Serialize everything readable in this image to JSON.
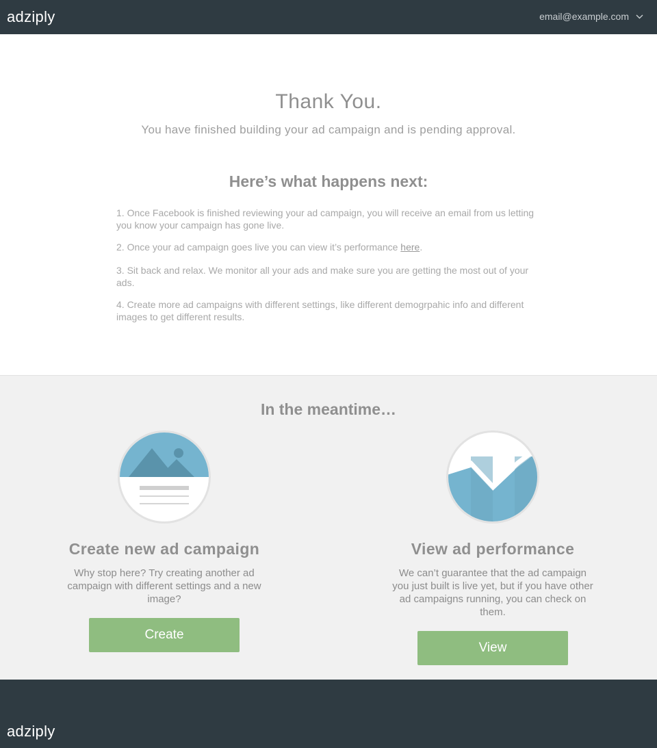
{
  "header": {
    "logo": "adziply",
    "account_email": "email@example.com",
    "account_icon": "chevron-down-icon"
  },
  "main": {
    "title": "Thank You.",
    "subtitle": "You have finished building your ad campaign and is pending approval.",
    "next_title": "Here’s what happens next:",
    "steps": [
      "1. Once Facebook is finished reviewing your ad campaign, you will receive an email from us letting you know your campaign has gone live.",
      "2. Once your ad campaign goes live you can view it’s performance ",
      "3. Sit back and relax. We monitor all your ads and make sure you are getting the most out of your ads.",
      "4. Create more ad campaigns with different settings, like different demogrpahic info and different images to get different results."
    ],
    "step2_link": "here",
    "step2_suffix": "."
  },
  "meantime": {
    "title": "In the meantime…",
    "cards": [
      {
        "icon": "image-document-icon",
        "title": "Create new ad campaign",
        "description": "Why stop here? Try creating another ad campaign with different settings and a new image?",
        "button": "Create"
      },
      {
        "icon": "line-chart-icon",
        "title": "View ad performance",
        "description": "We can’t guarantee that the ad campaign you just built is live yet, but if you have other ad campaigns running, you can check on them.",
        "button": "View"
      }
    ]
  },
  "footer": {
    "logo": "adziply"
  },
  "colors": {
    "header_bg": "#2f3b42",
    "button_green": "#8fbd80",
    "icon_blue": "#75b4cf",
    "section_bg": "#f1f1f1"
  }
}
